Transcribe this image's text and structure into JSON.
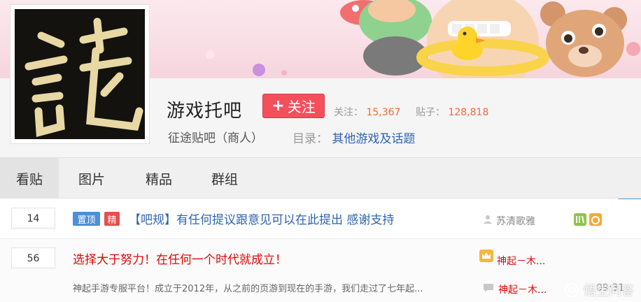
{
  "forum": {
    "name": "游戏托吧",
    "follow_label": "关注",
    "follow_stat_label": "关注：",
    "follow_count": "15,367",
    "post_stat_label": "贴子：",
    "post_count": "128,818",
    "sub_line": "征途贴吧（商人）",
    "catalog_label": "目录：",
    "catalog_value": "其他游戏及话题"
  },
  "tabs": [
    {
      "label": "看贴",
      "active": true
    },
    {
      "label": "图片",
      "active": false
    },
    {
      "label": "精品",
      "active": false
    },
    {
      "label": "群组",
      "active": false
    }
  ],
  "threads": [
    {
      "reply_count": "14",
      "badge_top": "置顶",
      "badge_good": "精",
      "title": "【吧规】有任何提议跟意见可以在此提出 感谢支持",
      "author": "苏清歌雅"
    },
    {
      "reply_count": "56",
      "title": "选择大于努力！在任何一个时代就成立！",
      "author": "神起－木...",
      "abstract": "神起手游专服平台！成立于2012年，从之前的页游到现在的手游，我们走过了七年起...",
      "last_author": "神起－木...",
      "last_time": "09:31"
    }
  ],
  "watermark": "悟空问答",
  "colors": {
    "follow_button": "#f4505c",
    "link_blue": "#2d64b3",
    "stat_orange": "#f06b32",
    "hot_red": "#e10602"
  }
}
